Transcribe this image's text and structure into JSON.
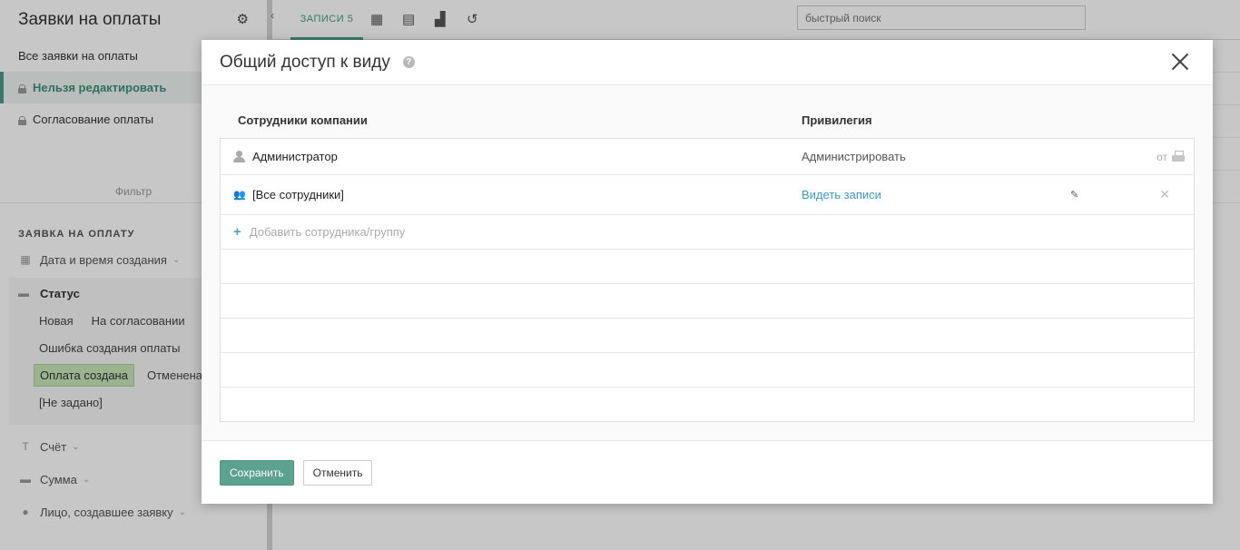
{
  "sidebar": {
    "title": "Заявки на оплаты",
    "views": [
      {
        "label": "Все заявки на оплаты"
      },
      {
        "label": "Нельзя редактировать"
      },
      {
        "label": "Согласование оплаты"
      }
    ],
    "filter_title": "Фильтр",
    "section_title": "ЗАЯВКА НА ОПЛАТУ",
    "fields": {
      "created": "Дата и время создания",
      "status": "Статус",
      "account": "Счёт",
      "sum": "Сумма",
      "creator": "Лицо, создавшее заявку"
    },
    "status_options": {
      "new": "Новая",
      "approval": "На согласовании",
      "error": "Ошибка создания оплаты",
      "created": "Оплата создана",
      "cancelled": "Отменена",
      "unset": "[Не задано]"
    }
  },
  "topbar": {
    "records_tab": "ЗАПИСИ 5",
    "search_placeholder": "быстрый поиск"
  },
  "modal": {
    "title": "Общий доступ к виду",
    "col_employees": "Сотрудники компании",
    "col_privilege": "Привилегия",
    "rows": [
      {
        "name": "Администратор",
        "privilege": "Администрировать",
        "from": "от"
      },
      {
        "name": "[Все сотрудники]",
        "privilege": "Видеть записи"
      }
    ],
    "add_label": "Добавить сотрудника/группу",
    "save_label": "Сохранить",
    "cancel_label": "Отменить"
  }
}
